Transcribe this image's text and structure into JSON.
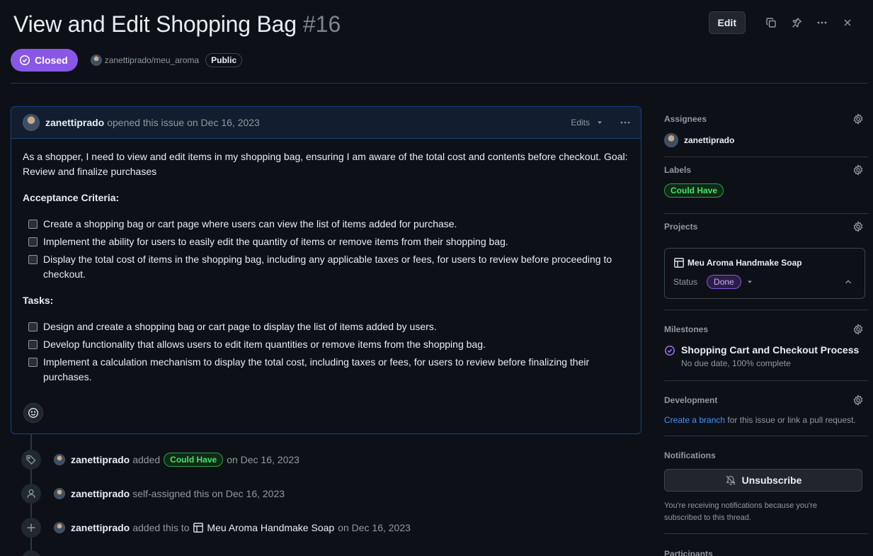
{
  "issue": {
    "title": "View and Edit Shopping Bag",
    "number": "#16",
    "state": "Closed",
    "repo": "zanettiprado/meu_aroma",
    "visibility": "Public"
  },
  "toolbar": {
    "edit_label": "Edit"
  },
  "comment": {
    "author": "zanettiprado",
    "opened_text": "opened this issue on Dec 16, 2023",
    "edits_label": "Edits",
    "intro": "As a shopper, I need to view and edit items in my shopping bag, ensuring I am aware of the total cost and contents before checkout. Goal: Review and finalize purchases",
    "acceptance_heading": "Acceptance Criteria:",
    "acceptance_items": [
      "Create a shopping bag or cart page where users can view the list of items added for purchase.",
      "Implement the ability for users to easily edit the quantity of items or remove items from their shopping bag.",
      "Display the total cost of items in the shopping bag, including any applicable taxes or fees, for users to review before proceeding to checkout."
    ],
    "tasks_heading": "Tasks:",
    "task_items": [
      "Design and create a shopping bag or cart page to display the list of items added by users.",
      "Develop functionality that allows users to edit item quantities or remove items from the shopping bag.",
      "Implement a calculation mechanism to display the total cost, including taxes or fees, for users to review before finalizing their purchases."
    ]
  },
  "timeline": [
    {
      "icon": "tag-icon",
      "actor": "zanettiprado",
      "action": "added",
      "label": "Could Have",
      "suffix": "on Dec 16, 2023"
    },
    {
      "icon": "person-icon",
      "actor": "zanettiprado",
      "action": "self-assigned this on Dec 16, 2023"
    },
    {
      "icon": "plus-icon",
      "actor": "zanettiprado",
      "action": "added this to",
      "project": "Meu Aroma Handmake Soap",
      "suffix": "on Dec 16, 2023"
    }
  ],
  "sidebar": {
    "assignees": {
      "title": "Assignees",
      "user": "zanettiprado"
    },
    "labels": {
      "title": "Labels",
      "label": "Could Have"
    },
    "projects": {
      "title": "Projects",
      "name": "Meu Aroma Handmake Soap",
      "status_label": "Status",
      "status_value": "Done"
    },
    "milestones": {
      "title": "Milestones",
      "name": "Shopping Cart and Checkout Process",
      "sub": "No due date, 100% complete"
    },
    "development": {
      "title": "Development",
      "link": "Create a branch",
      "text": " for this issue or link a pull request."
    },
    "notifications": {
      "title": "Notifications",
      "button": "Unsubscribe",
      "text": "You're receiving notifications because you're subscribed to this thread."
    },
    "participants": {
      "title": "Participants"
    }
  },
  "colors": {
    "closed": "#8957e5",
    "label_green": "#2ea043",
    "link": "#4493f8",
    "background": "#0d1117"
  }
}
